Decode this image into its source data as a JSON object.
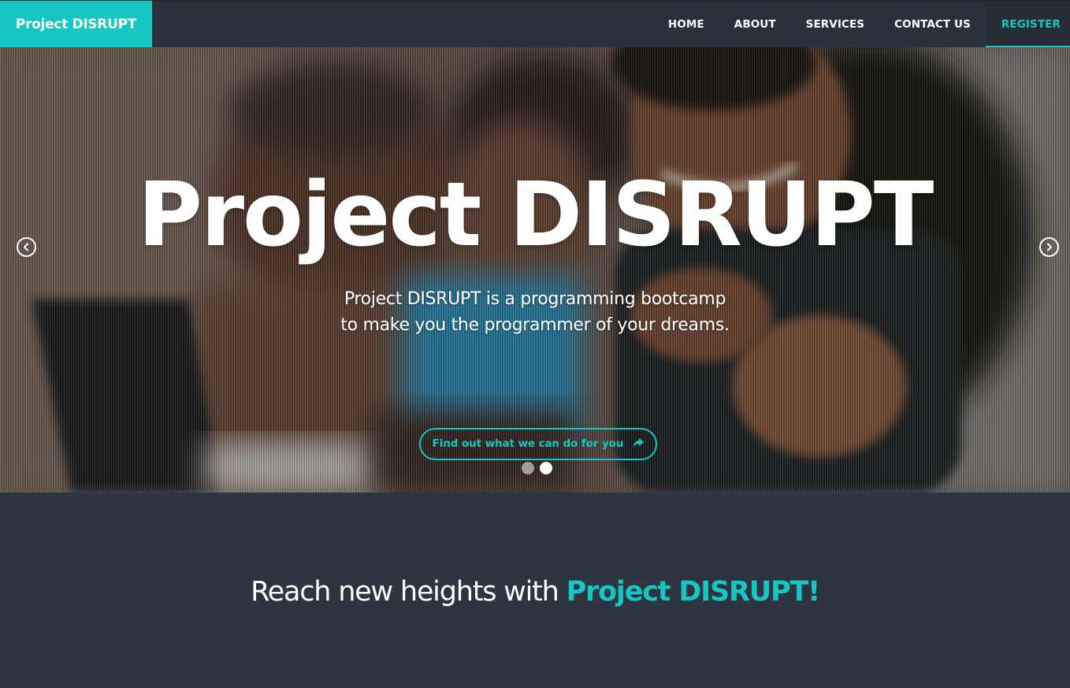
{
  "brand": {
    "name": "Project DISRUPT",
    "color": "#16c6c2"
  },
  "nav": {
    "items": [
      {
        "label": "HOME"
      },
      {
        "label": "ABOUT"
      },
      {
        "label": "SERVICES"
      },
      {
        "label": "CONTACT US"
      },
      {
        "label": "REGISTER",
        "active": true
      }
    ]
  },
  "hero": {
    "title": "Project DISRUPT",
    "subtitle_line1": "Project DISRUPT is a programming bootcamp",
    "subtitle_line2": "to make you the programmer of your dreams.",
    "cta_label": "Find out what we can do for you",
    "cta_icon": "share-arrow-icon",
    "prev_icon": "chevron-left-icon",
    "next_icon": "chevron-right-icon",
    "slide_count": 2,
    "active_slide": 2
  },
  "intro": {
    "heading_prefix": "Reach new heights with ",
    "heading_accent": "Project DISRUPT!"
  },
  "colors": {
    "accent": "#16c6c2",
    "navbar": "#2b313c",
    "section_bg": "#2e3440"
  }
}
